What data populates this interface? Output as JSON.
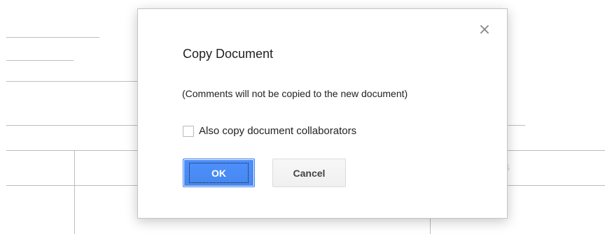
{
  "background": {
    "ghost_text": "es"
  },
  "dialog": {
    "title": "Copy Document",
    "close_label": "×",
    "note": "(Comments will not be copied to the new document)",
    "checkbox": {
      "label": "Also copy document collaborators",
      "checked": false
    },
    "buttons": {
      "ok_label": "OK",
      "cancel_label": "Cancel"
    }
  },
  "colors": {
    "primary_button": "#4d90fe",
    "primary_border": "#3079ed",
    "secondary_button": "#f5f5f5"
  }
}
